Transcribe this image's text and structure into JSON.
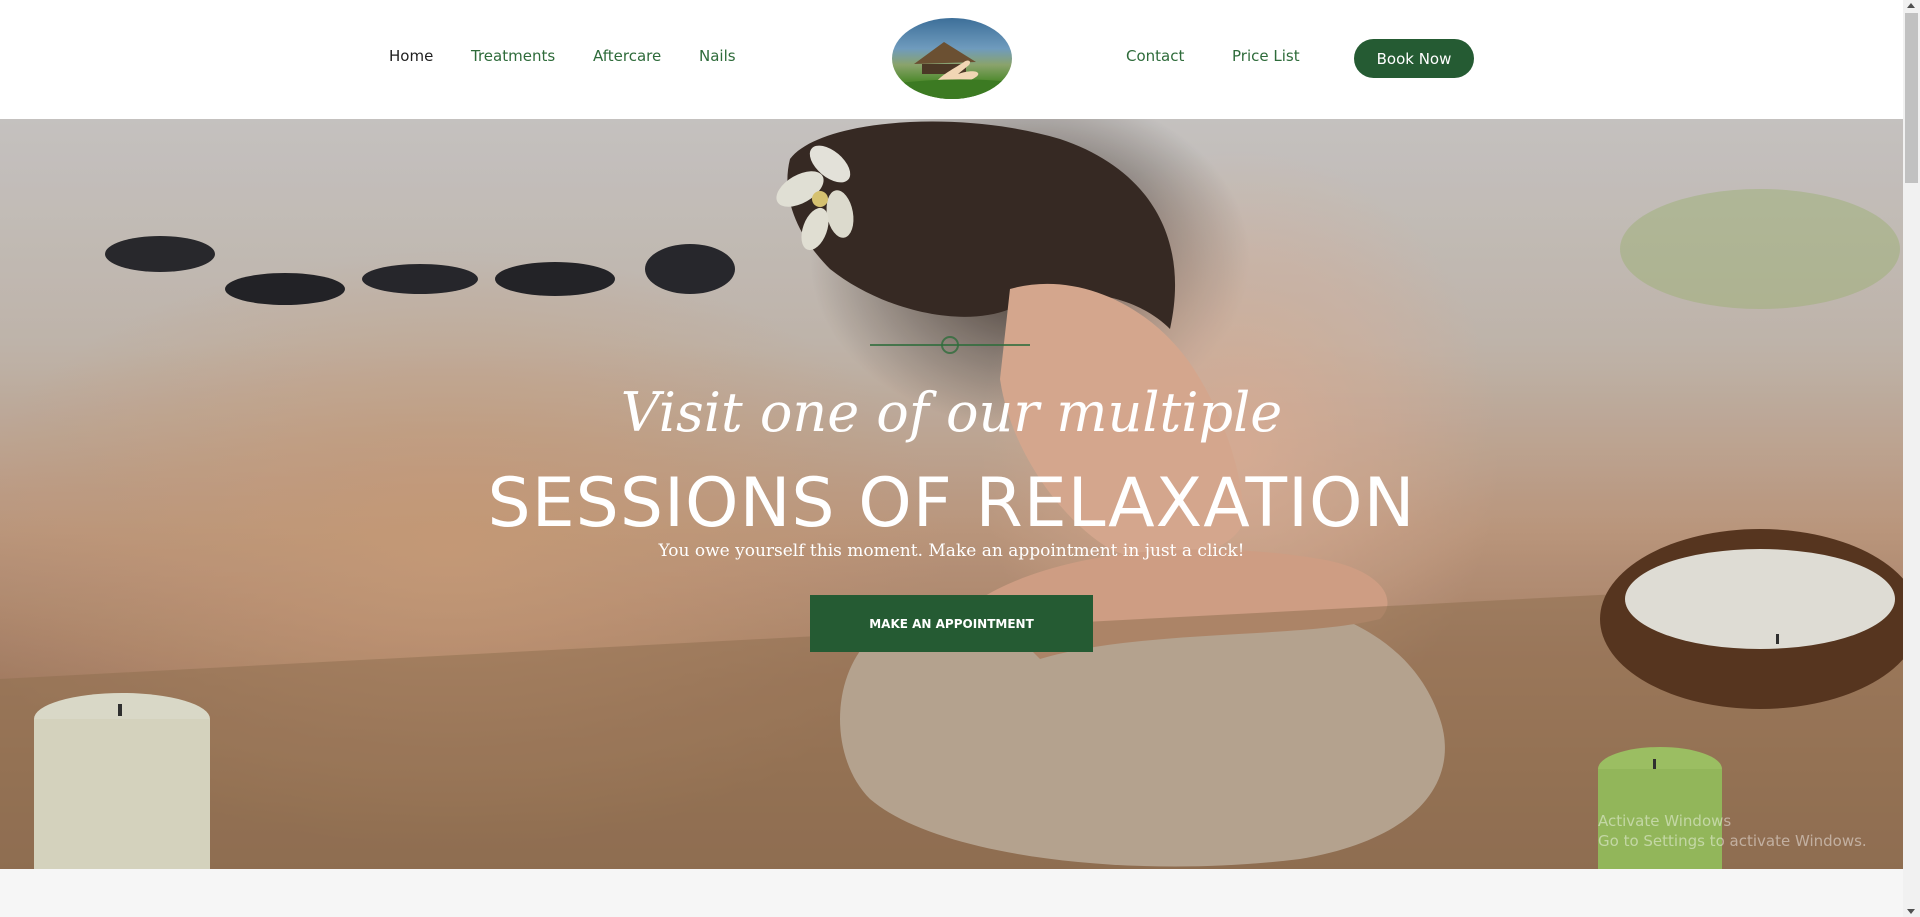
{
  "nav": {
    "left": [
      {
        "label": "Home",
        "active": true
      },
      {
        "label": "Treatments"
      },
      {
        "label": "Aftercare"
      },
      {
        "label": "Nails"
      }
    ],
    "right": [
      {
        "label": "Contact"
      },
      {
        "label": "Price List"
      }
    ],
    "book_label": "Book Now"
  },
  "hero": {
    "script_line": "Visit one of our multiple",
    "title": "SESSIONS OF RELAXATION",
    "subtitle": "You owe yourself this moment. Make an appointment in just a click!",
    "button_label": "MAKE AN APPOINTMENT"
  },
  "watermark": {
    "line1": "Activate Windows",
    "line2": "Go to Settings to activate Windows."
  },
  "colors": {
    "brand_green": "#255b33",
    "nav_text": "#2e6b3a",
    "active_nav": "#1f1f1f"
  },
  "icons": {
    "logo": "spa-hut-hand-logo"
  }
}
